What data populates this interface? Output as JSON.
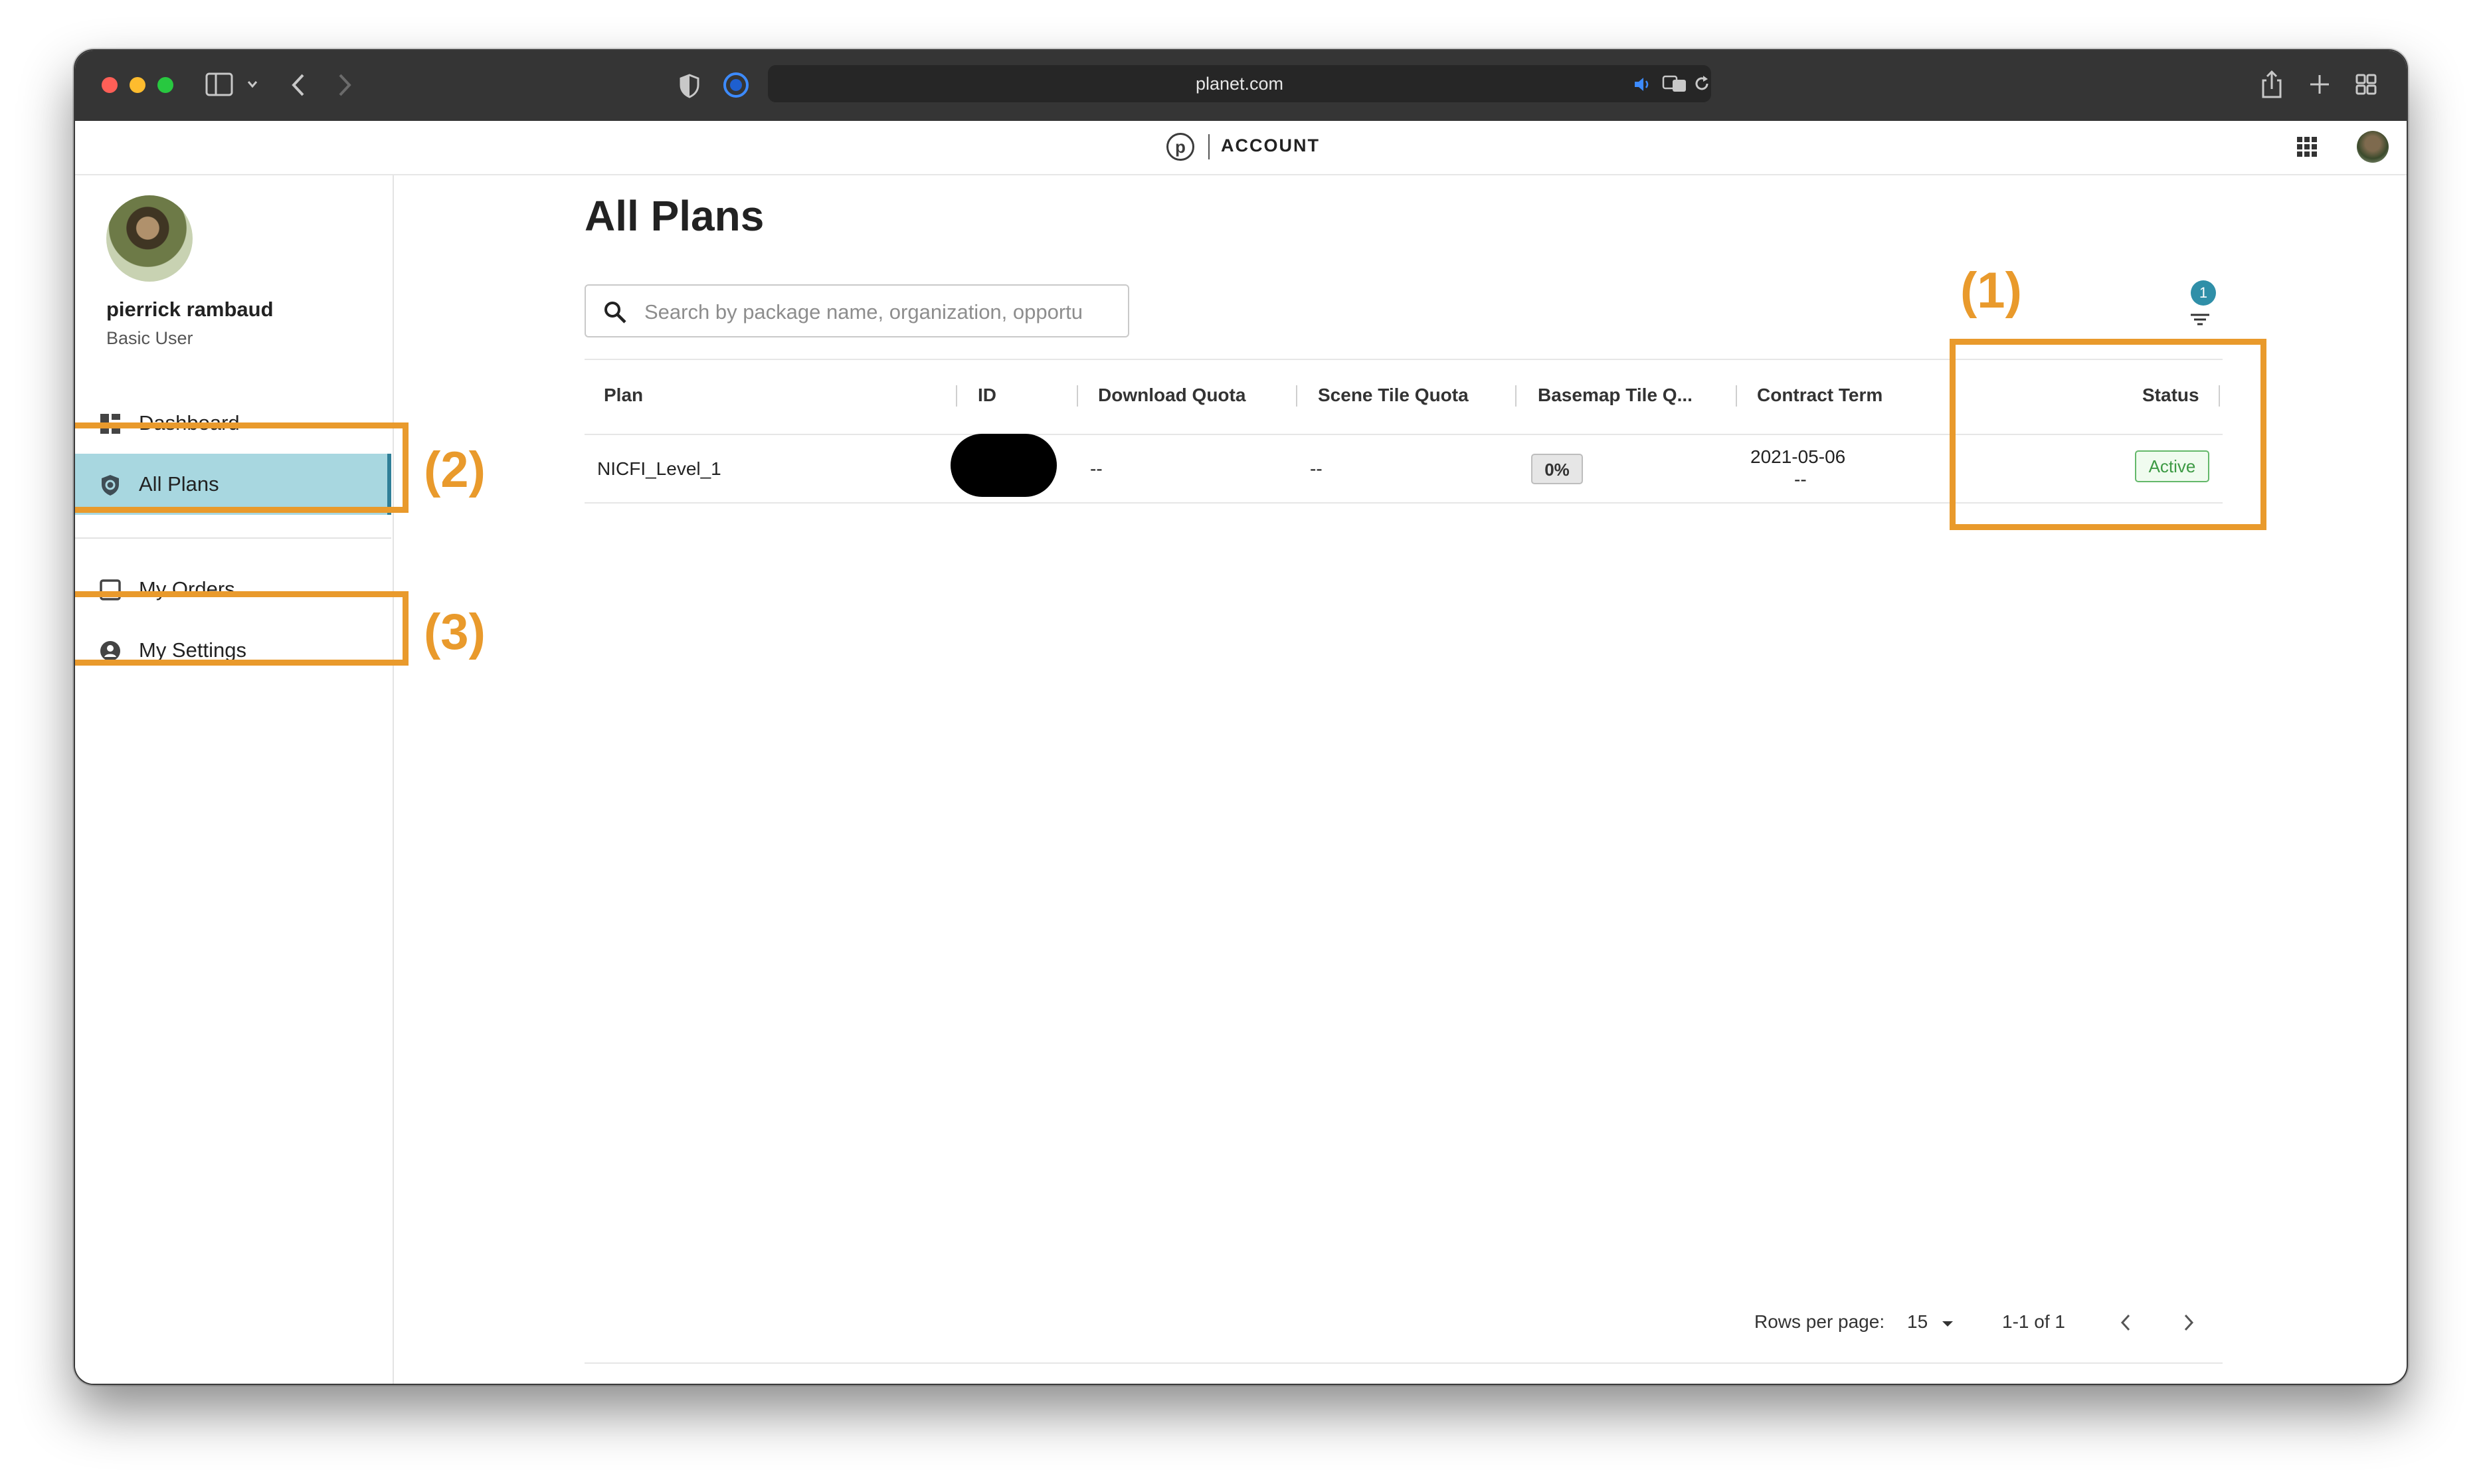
{
  "browser": {
    "url": "planet.com"
  },
  "app": {
    "header_label": "ACCOUNT",
    "logo_letter": "p"
  },
  "user": {
    "name": "pierrick rambaud",
    "role": "Basic User"
  },
  "sidebar": {
    "items": [
      {
        "label": "Dashboard",
        "icon": "dashboard-icon"
      },
      {
        "label": "All Plans",
        "icon": "shield-icon",
        "active": true
      },
      {
        "label": "My Orders",
        "icon": "inbox-icon"
      },
      {
        "label": "My Settings",
        "icon": "user-circle-icon"
      }
    ]
  },
  "annotations": [
    "(1)",
    "(2)",
    "(3)"
  ],
  "main": {
    "title": "All Plans",
    "search_placeholder": "Search by package name, organization, opportu",
    "filter_badge": "1",
    "columns": [
      "Plan",
      "ID",
      "Download Quota",
      "Scene Tile Quota",
      "Basemap Tile Q...",
      "Contract Term",
      "Status"
    ],
    "rows": [
      {
        "plan": "NICFI_Level_1",
        "download_quota": "--",
        "scene_tile_quota": "--",
        "basemap_tile_quota": "0%",
        "contract_start": "2021-05-06",
        "contract_end": "--",
        "status": "Active"
      }
    ],
    "pagination": {
      "rows_per_page_label": "Rows per page:",
      "rows_per_page": "15",
      "range": "1-1 of 1"
    }
  },
  "colors": {
    "accent_annotation": "#e99a2c",
    "active_nav_bg": "#a8d7e0",
    "status_active": "#3d9a44",
    "badge": "#2f8fa8"
  }
}
